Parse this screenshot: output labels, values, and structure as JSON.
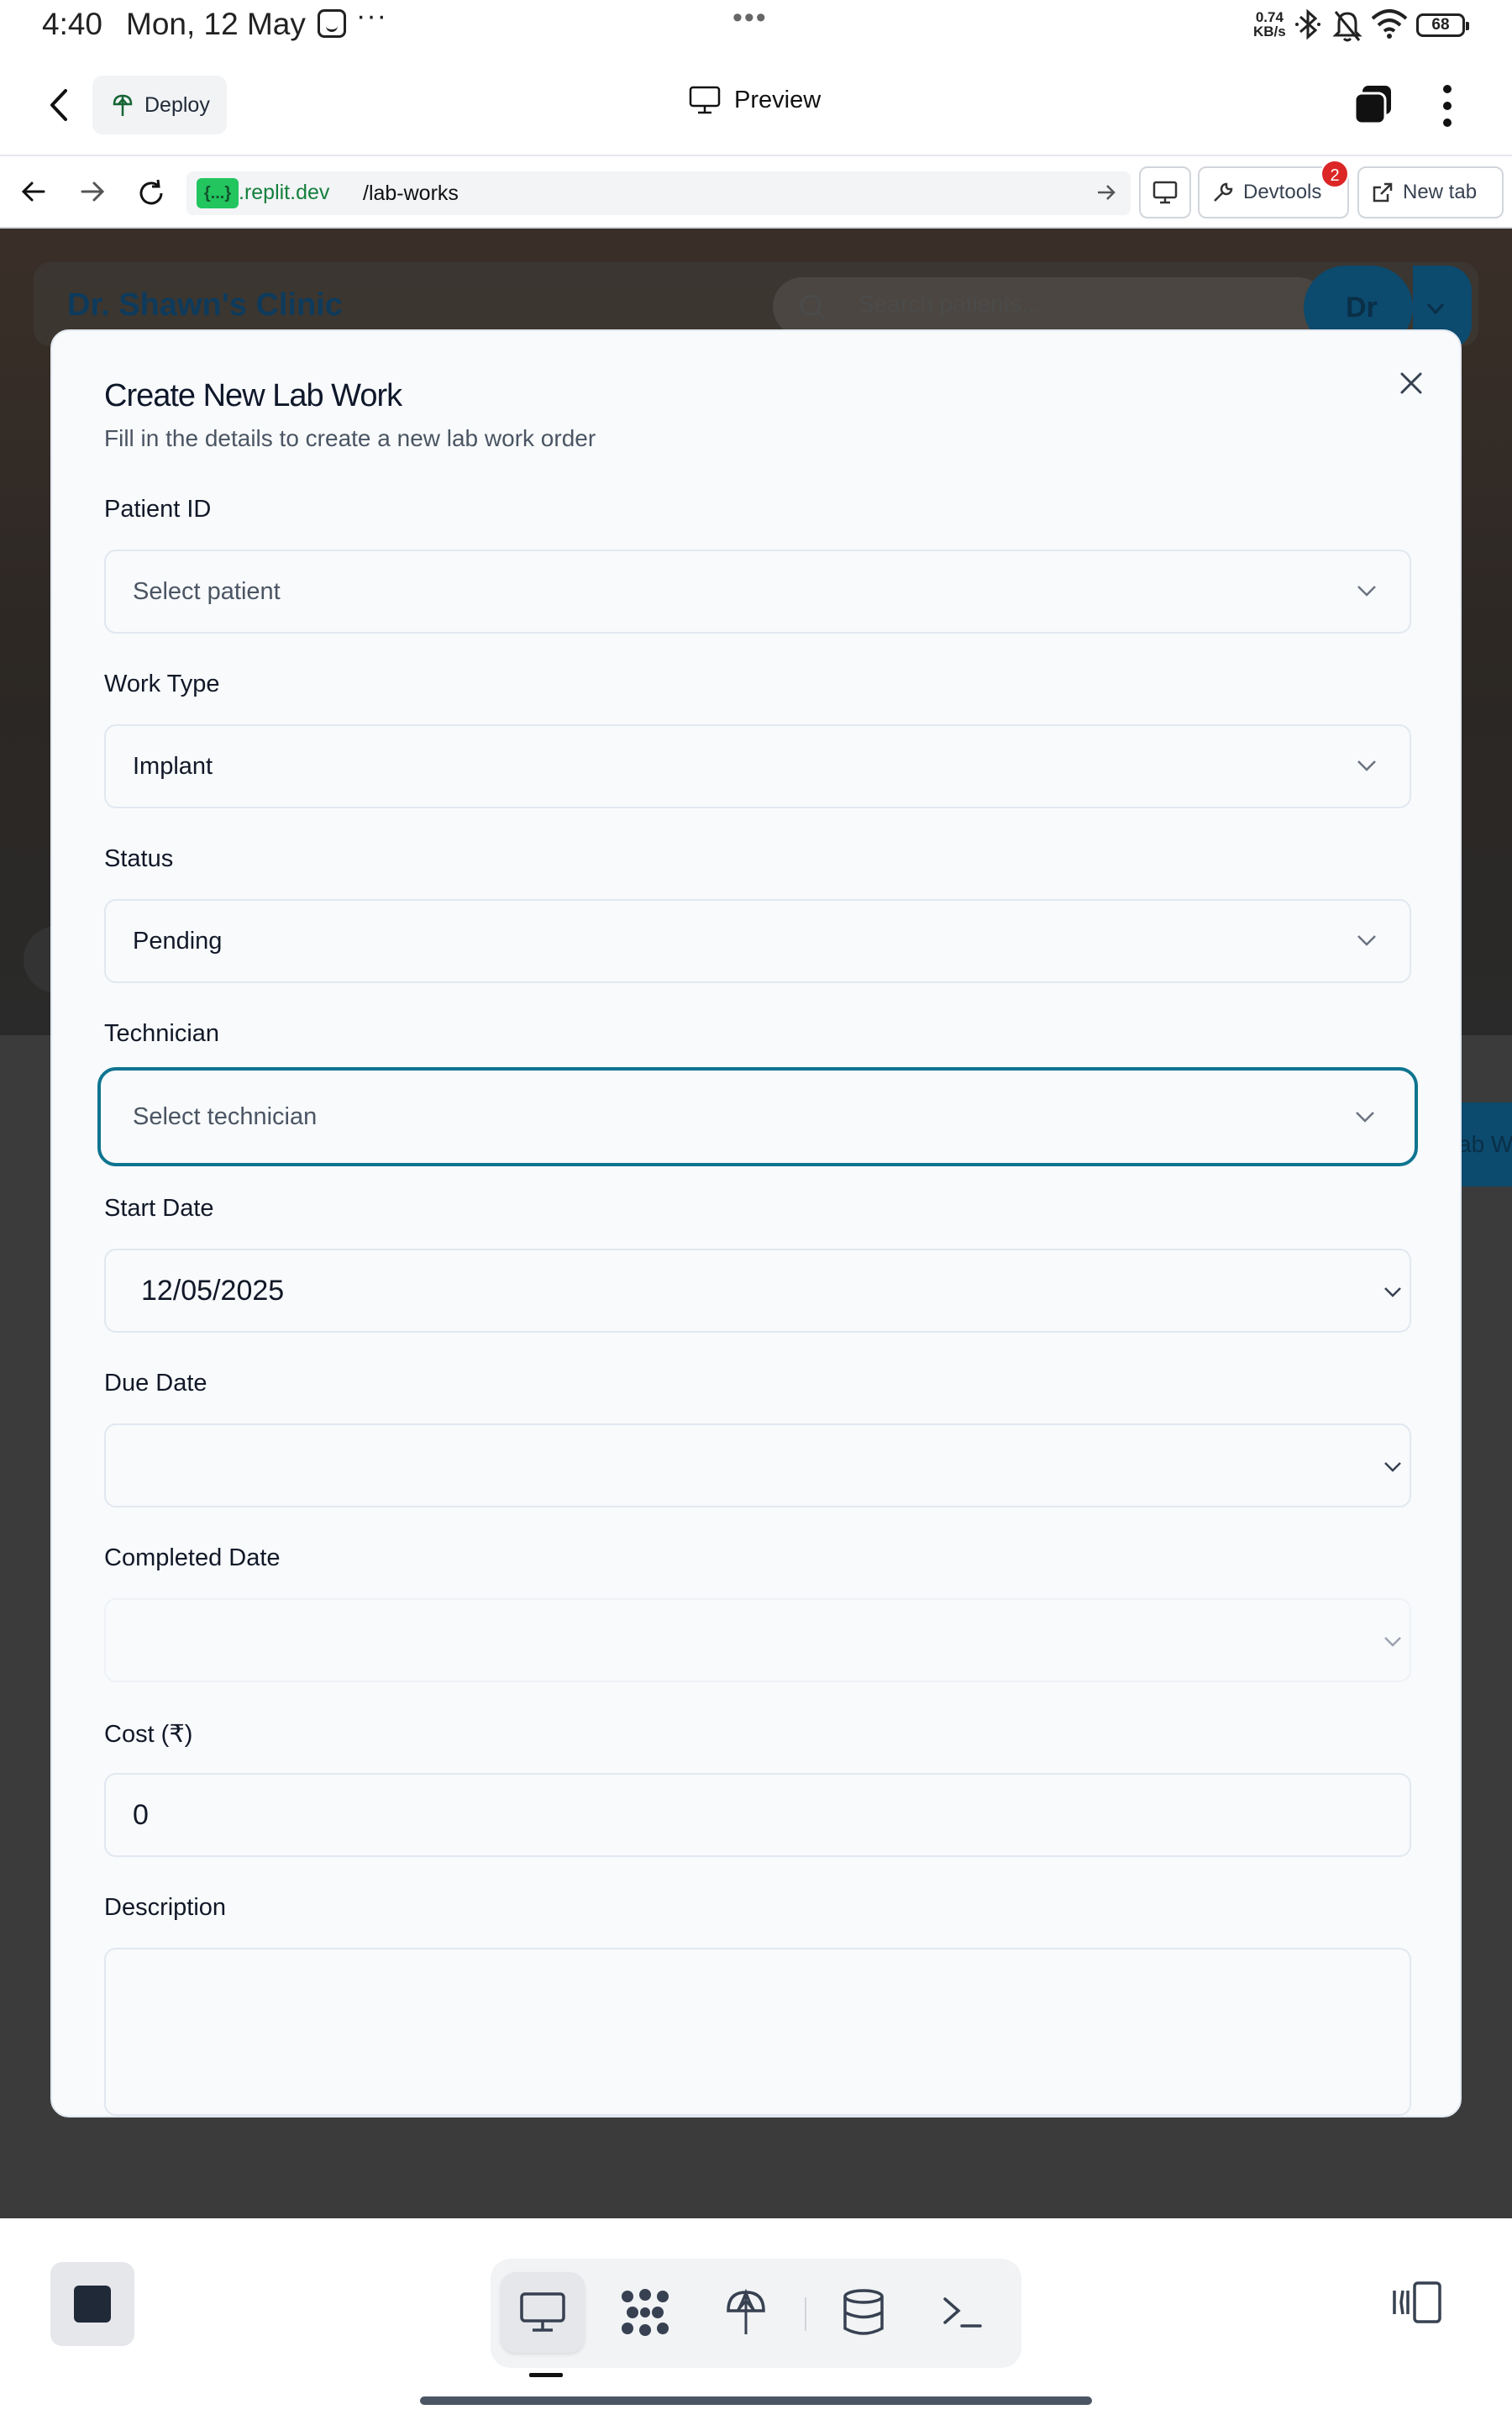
{
  "status_bar": {
    "time": "4:40",
    "date": "Mon, 12 May",
    "more": "···",
    "center_dots": "•••",
    "net_speed_value": "0.74",
    "net_speed_unit": "KB/s",
    "battery": "68"
  },
  "app_header": {
    "deploy_label": "Deploy",
    "preview_label": "Preview"
  },
  "url_bar": {
    "badge": "{...}",
    "domain": ".replit.dev",
    "path": "/lab-works",
    "devtools_label": "Devtools",
    "devtools_badge": "2",
    "new_tab_label": "New tab"
  },
  "background_app": {
    "clinic_title": "Dr. Shawn's Clinic",
    "search_placeholder": "Search patients...",
    "avatar_initials": "Dr",
    "partial_button": "ab W"
  },
  "modal": {
    "title": "Create New Lab Work",
    "subtitle": "Fill in the details to create a new lab work order",
    "fields": {
      "patient_id": {
        "label": "Patient ID",
        "placeholder": "Select patient"
      },
      "work_type": {
        "label": "Work Type",
        "value": "Implant"
      },
      "status": {
        "label": "Status",
        "value": "Pending"
      },
      "technician": {
        "label": "Technician",
        "placeholder": "Select technician"
      },
      "start_date": {
        "label": "Start Date",
        "value": "12/05/2025"
      },
      "due_date": {
        "label": "Due Date",
        "value": ""
      },
      "completed_date": {
        "label": "Completed Date",
        "value": ""
      },
      "cost": {
        "label": "Cost (₹)",
        "value": "0"
      },
      "description": {
        "label": "Description",
        "value": ""
      }
    }
  },
  "colors": {
    "focus_ring": "#0e7490",
    "brand_dark": "#0c4a6e",
    "url_badge": "#22c55e",
    "devtools_badge": "#dc2626"
  },
  "icons": {
    "back": "chevron-left-icon",
    "deploy": "deploy-icon",
    "preview": "monitor-icon",
    "tabs": "tabs-icon",
    "menu": "kebab-icon",
    "nav_back": "arrow-left-icon",
    "nav_forward": "arrow-right-icon",
    "reload": "reload-icon",
    "close": "close-icon",
    "dock": [
      "monitor-icon",
      "agent-icon",
      "deploy-icon",
      "database-icon",
      "terminal-icon"
    ]
  }
}
